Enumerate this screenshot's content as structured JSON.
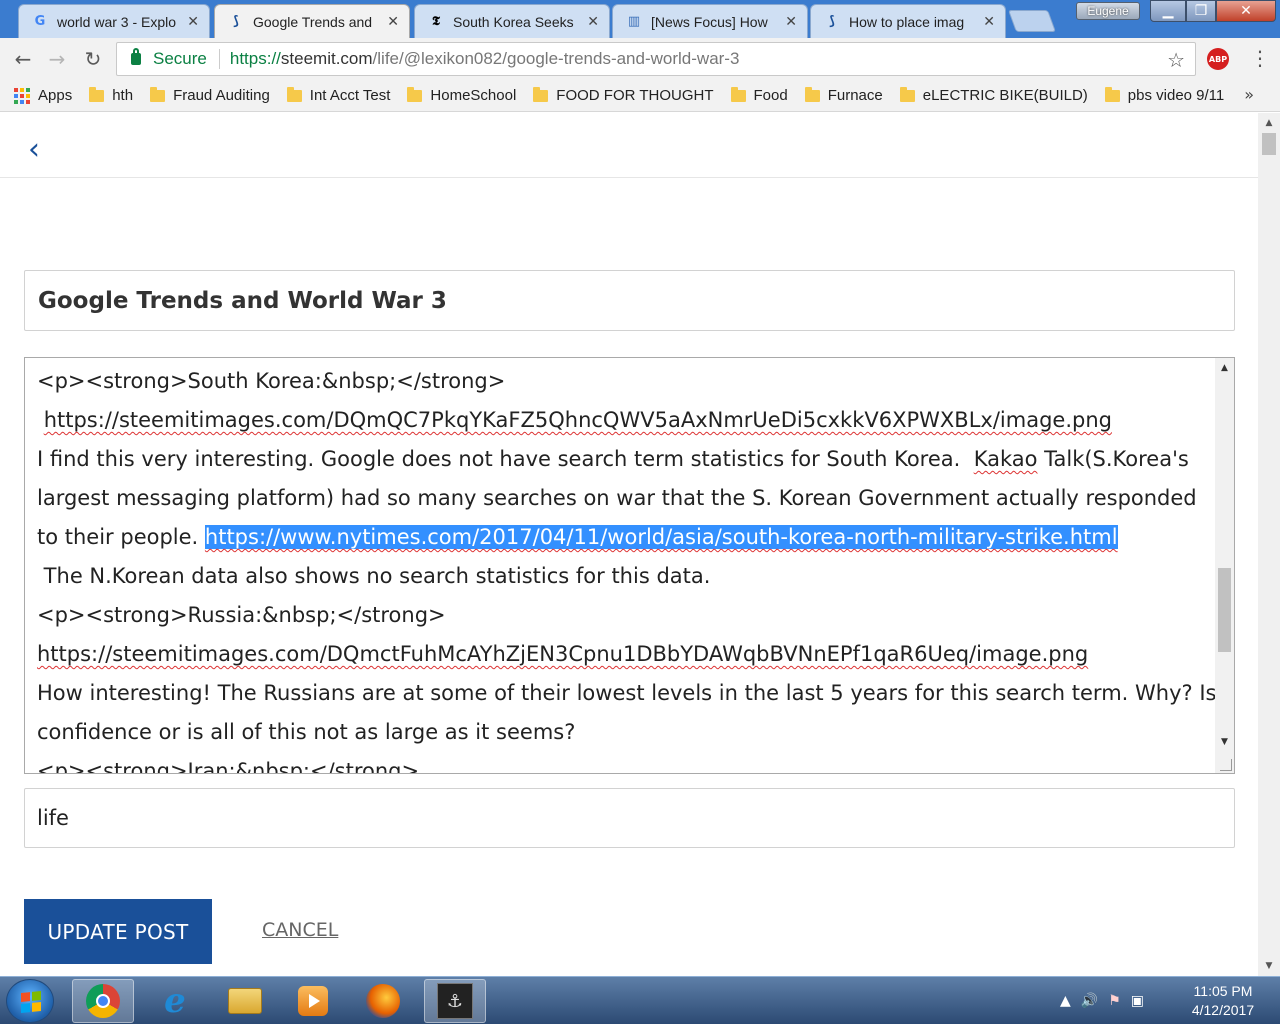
{
  "browser": {
    "tabs": [
      {
        "title": "world war 3 - Explo",
        "icon": "google-icon",
        "close": "✕"
      },
      {
        "title": "Google Trends and",
        "icon": "steemit-icon",
        "close": "✕"
      },
      {
        "title": "South Korea Seeks",
        "icon": "nytimes-icon",
        "close": "✕"
      },
      {
        "title": "[News Focus] How",
        "icon": "news-icon",
        "close": "✕"
      },
      {
        "title": "How to place imag",
        "icon": "steemit-icon",
        "close": "✕"
      }
    ],
    "user_name": "Eugene",
    "security_label": "Secure",
    "url_protocol": "https://",
    "url_domain": "steemit.com",
    "url_path": "/life/@lexikon082/google-trends-and-world-war-3",
    "abp_label": "ABP",
    "bookmarks": [
      {
        "label": "Apps",
        "icon": "apps-grid-icon"
      },
      {
        "label": "hth",
        "icon": "folder-icon"
      },
      {
        "label": "Fraud Auditing",
        "icon": "folder-icon"
      },
      {
        "label": "Int Acct Test",
        "icon": "folder-icon"
      },
      {
        "label": "HomeSchool",
        "icon": "folder-icon"
      },
      {
        "label": "FOOD FOR THOUGHT",
        "icon": "folder-icon"
      },
      {
        "label": "Food",
        "icon": "folder-icon"
      },
      {
        "label": "Furnace",
        "icon": "folder-icon"
      },
      {
        "label": "eLECTRIC BIKE(BUILD)",
        "icon": "folder-icon"
      },
      {
        "label": "pbs video 9/11",
        "icon": "folder-icon"
      }
    ],
    "more_bookmarks": "»"
  },
  "editor_page": {
    "title_value": "Google Trends and World War 3",
    "body_lines": {
      "l1": "<p><strong>South Korea:&nbsp;</strong>",
      "l2_prefix": " ",
      "l2_link": "https://steemitimages.com/DQmQC7PkqYKaFZ5QhncQWV5aAxNmrUeDi5cxkkV6XPWXBLx/image.png",
      "l3_a": "I find this very interesting. Google does not have search term statistics for South Korea.  ",
      "l3_kakao": "Kakao",
      "l3_b": " Talk(S.Korea's",
      "l4": "largest messaging platform) had so many searches on war that the S. Korean Government actually responded",
      "l5_a": "to their people. ",
      "l5_selected": "https://www.nytimes.com/2017/04/11/world/asia/south-korea-north-military-strike.html",
      "l6": " The N.Korean data also shows no search statistics for this data.",
      "l7": "<p><strong>Russia:&nbsp;</strong>",
      "l8_link": "https://steemitimages.com/DQmctFuhMcAYhZjEN3Cpnu1DBbYDAWqbBVNnEPf1qaR6Ueq/image.png",
      "l9": "How interesting! The Russians are at some of their lowest levels in the last 5 years for this search term. Why? Is it",
      "l10": "confidence or is all of this not as large as it seems?",
      "l11": "<p><strong>Iran:&nbsp;</strong>"
    },
    "tags_value": "life",
    "update_label": "UPDATE POST",
    "cancel_label": "CANCEL"
  },
  "taskbar": {
    "time": "11:05 PM",
    "date": "4/12/2017",
    "apps": [
      "chrome-icon",
      "internet-explorer-icon",
      "file-explorer-icon",
      "media-player-icon",
      "firefox-icon",
      "world-of-warships-icon"
    ]
  }
}
